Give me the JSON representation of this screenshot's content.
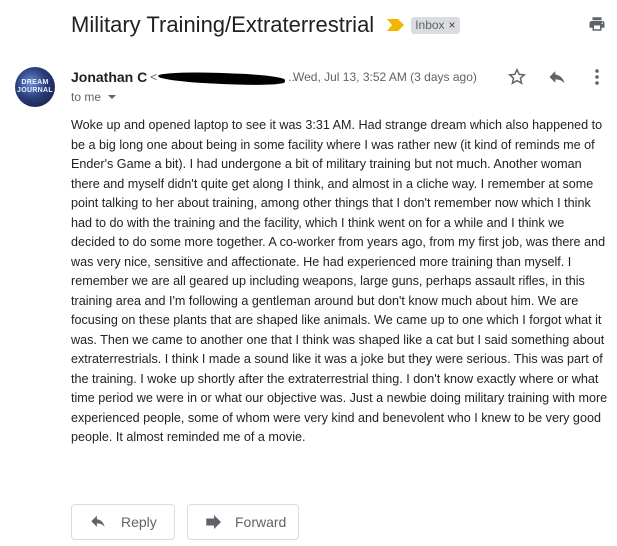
{
  "email": {
    "subject": "Military Training/Extraterrestrial",
    "label_chip": "Inbox",
    "label_chip_close": "×",
    "sender": {
      "name": "Jonathan C",
      "email_prefix": "<",
      "truncation": "..."
    },
    "avatar_text": "DREAM\nJOURNAL",
    "date": "Wed, Jul 13, 3:52 AM (3 days ago)",
    "to": "to me",
    "body": "Woke up and opened laptop to see it was 3:31 AM. Had strange dream which also happened to be a big long one about being in some facility where I was rather new (it kind of reminds me of Ender's Game a bit). I had undergone a bit of military training but not much. Another woman there and myself didn't quite get along I think, and almost in a cliche way. I remember at some point talking to her about training, among other things that I don't remember now which I think had to do with the training and the facility, which I think went on for a while and I think we decided to do some more together. A co-worker from years ago, from my first job, was there and was very nice, sensitive and affectionate. He had experienced more training than myself. I remember we are all geared up including weapons, large guns, perhaps assault rifles, in this training area and I'm following a gentleman around but don't know much about him. We are focusing on these plants that are shaped like animals. We came up to one which I forgot what it was. Then we came to another one that I think was shaped like a cat but I said something about extraterrestrials. I think I made a sound like it was a joke but they were serious. This was part of the training. I woke up shortly after the extraterrestrial thing. I don't know exactly where or what time period we were in or what our objective was. Just a newbie doing military training with more experienced people, some of whom were very kind and benevolent who I knew to be very good people. It almost reminded me of a movie."
  },
  "actions": {
    "reply_label": "Reply",
    "forward_label": "Forward"
  },
  "icons": {
    "importance": "importance-marker-icon",
    "print": "print-icon",
    "star": "star-icon",
    "reply": "reply-icon",
    "more": "more-vert-icon",
    "caret": "chevron-down-icon"
  },
  "colors": {
    "importance": "#f4b400",
    "chip_bg": "#dadce0",
    "text_secondary": "#5f6368"
  }
}
